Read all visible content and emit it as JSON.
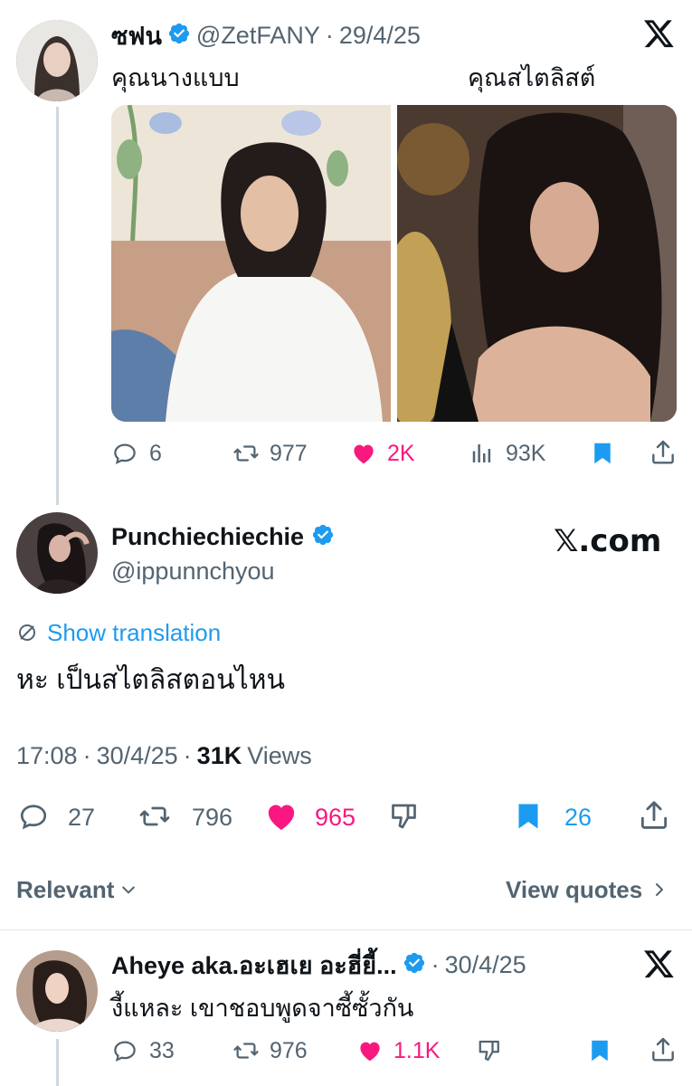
{
  "tweet1": {
    "name": "ซฟน",
    "handle": "@ZetFANY",
    "dot": "·",
    "date": "29/4/25",
    "label_left": "คุณนางแบบ",
    "label_right": "คุณสไตลิสต์",
    "metrics": {
      "replies": "6",
      "retweets": "977",
      "likes": "2K",
      "views": "93K"
    }
  },
  "tweet2": {
    "name": "Punchiechiechie",
    "handle": "@ippunnchyou",
    "watermark": "𝕏.com",
    "show_translation": "Show translation",
    "text": "หะ เป็นสไตลิสตอนไหน",
    "time": "17:08",
    "dot": "·",
    "date": "30/4/25",
    "views_count": "31K",
    "views_label": "Views",
    "metrics": {
      "replies": "27",
      "retweets": "796",
      "likes": "965",
      "bookmarks": "26"
    }
  },
  "sort": {
    "relevant": "Relevant",
    "view_quotes": "View quotes"
  },
  "tweet3": {
    "name": "Aheye aka.อะเฮเย อะฮี่ยี้...",
    "dot": "·",
    "date": "30/4/25",
    "text": "งี้แหละ เขาชอบพูดจาซี้ซั้วกัน",
    "metrics": {
      "replies": "33",
      "retweets": "976",
      "likes": "1.1K"
    }
  },
  "colors": {
    "like": "#f91880",
    "accent": "#1d9bf0",
    "muted": "#536471",
    "verified": "#1d9bf0"
  }
}
